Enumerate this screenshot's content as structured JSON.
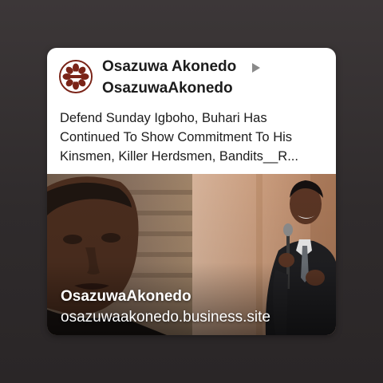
{
  "post": {
    "author": "Osazuwa Akonedo",
    "recipient": "OsazuwaAkonedo",
    "text_lines": [
      "Defend Sunday Igboho, Buhari Has",
      "Continued To Show Commitment To His",
      "Kinsmen, Killer Herdsmen, Bandits__R..."
    ]
  },
  "link_preview": {
    "title": "OsazuwaAkonedo",
    "domain": "osazuwaakonedo.business.site"
  },
  "icons": {
    "avatar": "logo-avatar-icon",
    "arrow": "share-arrow-icon"
  },
  "colors": {
    "background": "#332f30",
    "card": "#ffffff",
    "text": "#1c1c1c",
    "logo": "#7a2418"
  }
}
